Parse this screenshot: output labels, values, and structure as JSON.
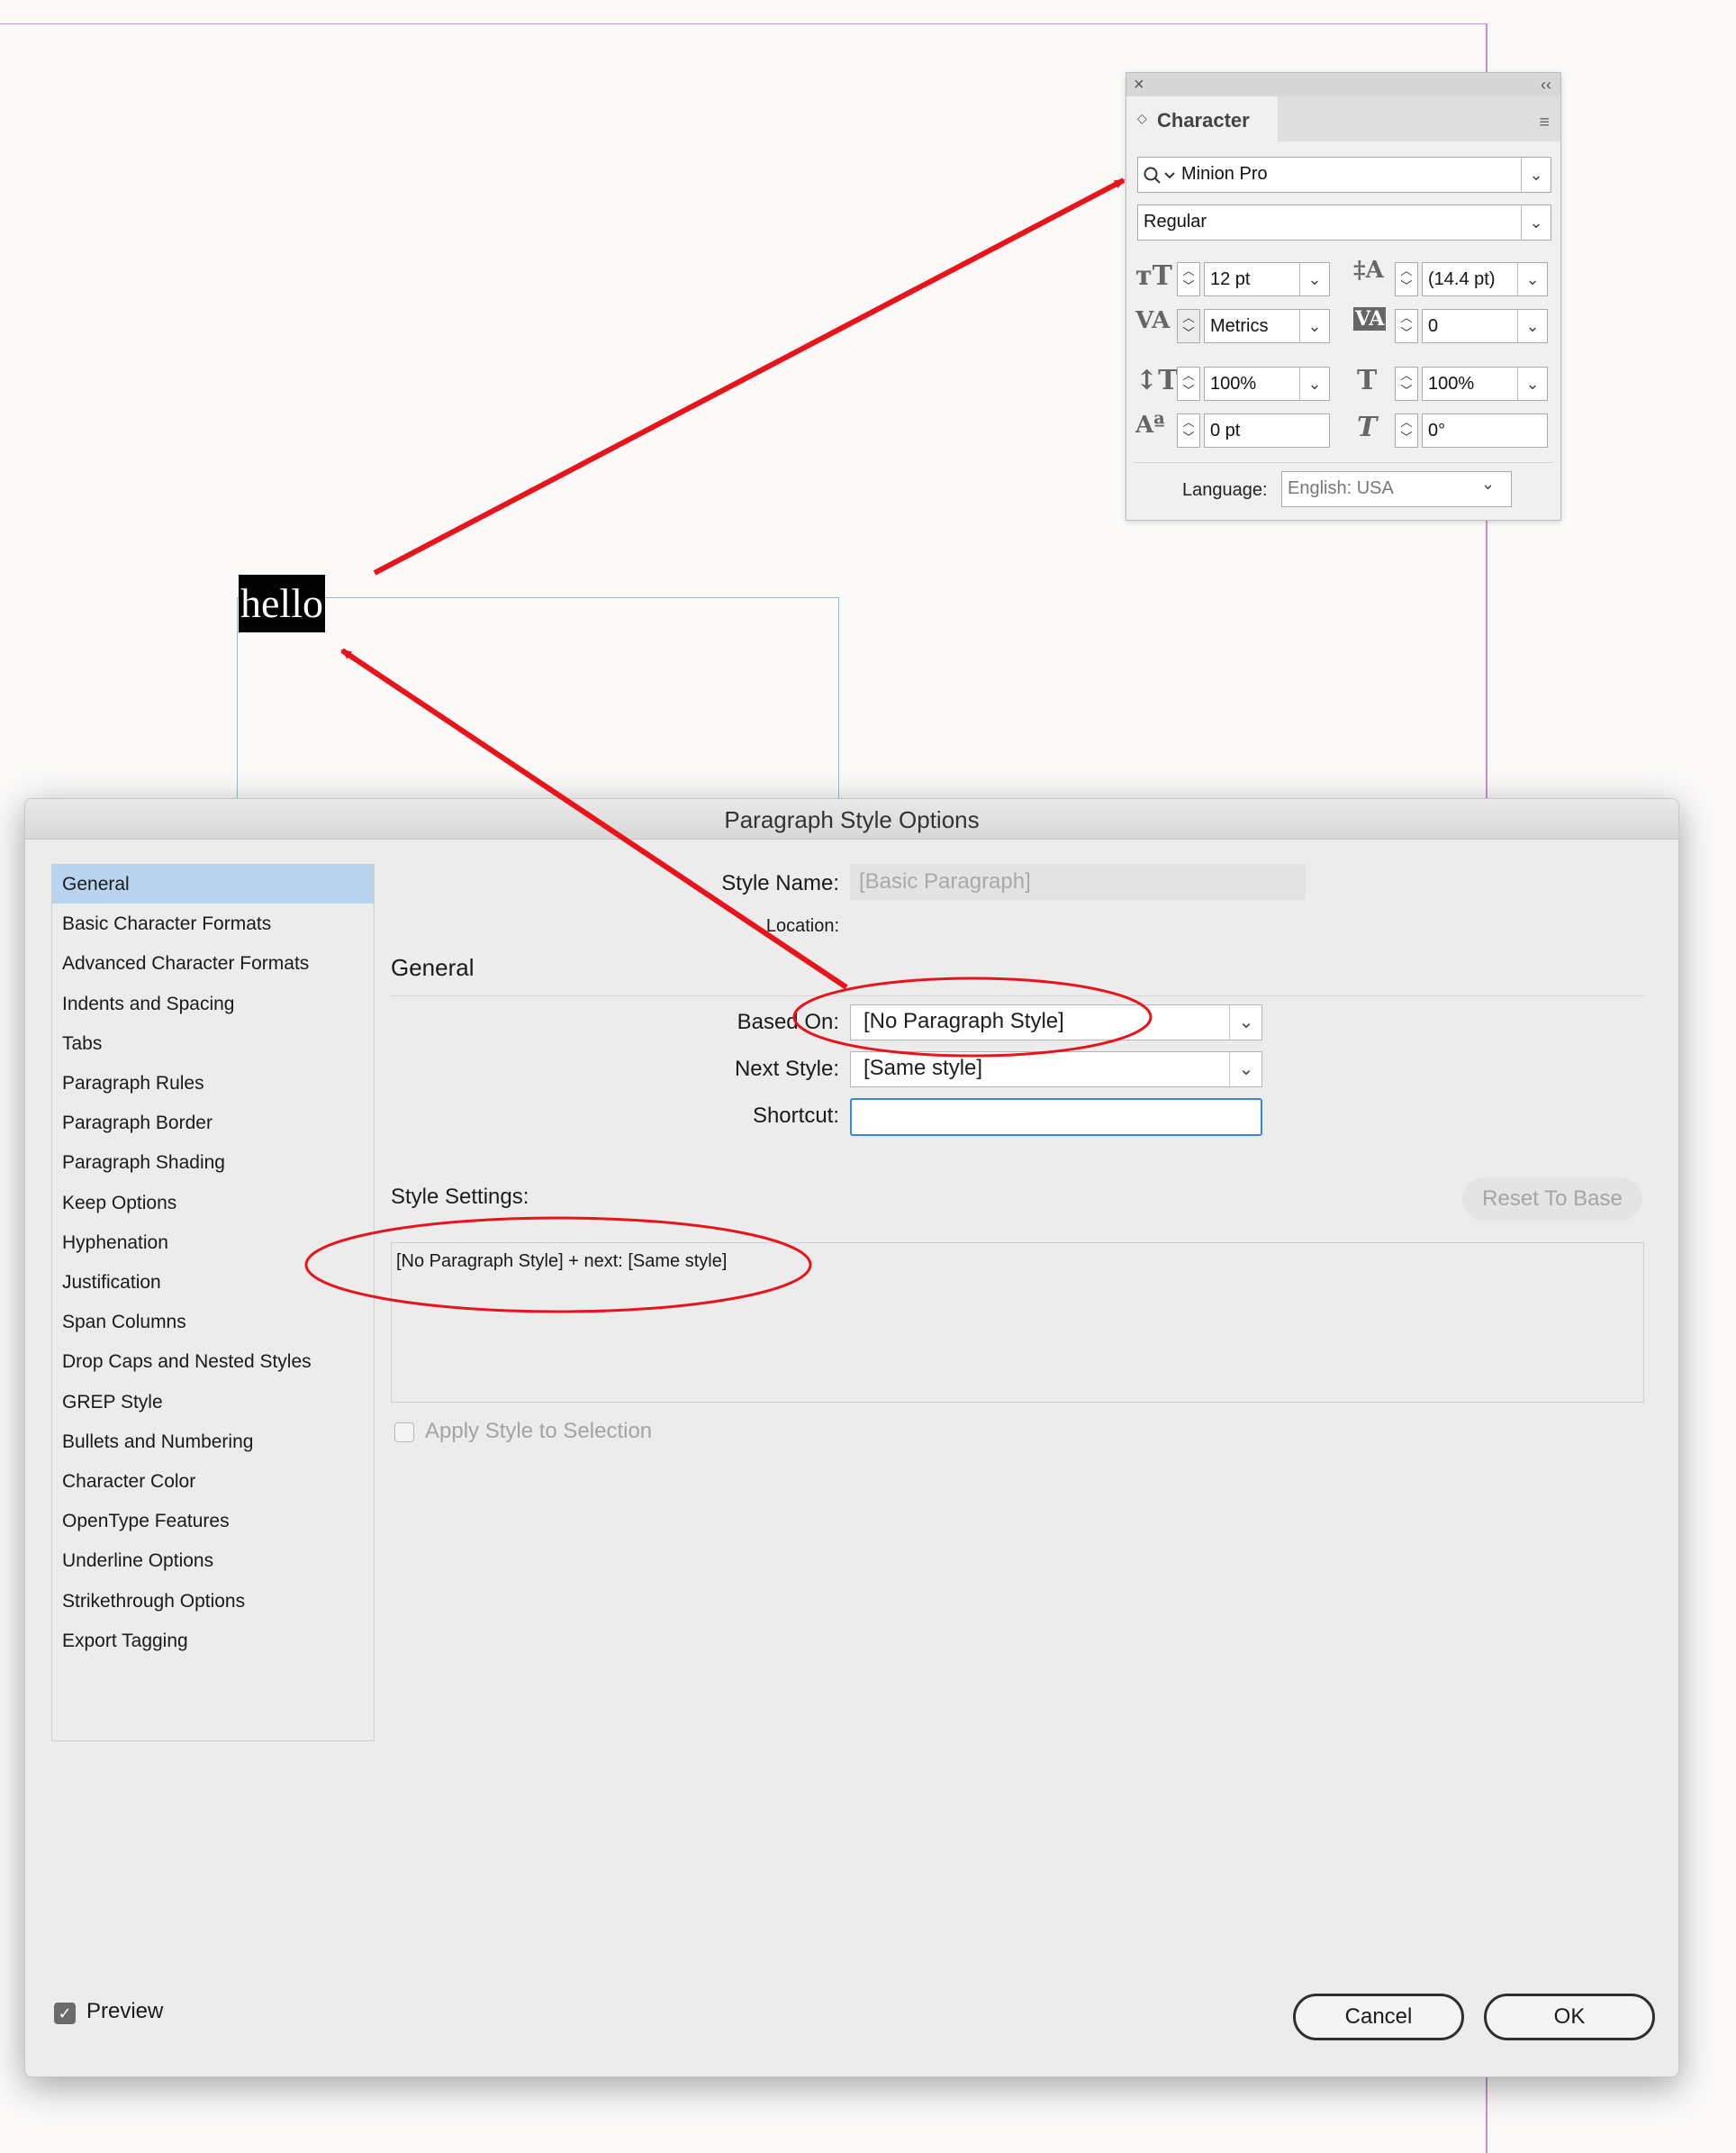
{
  "canvas": {
    "sample_text": "hello"
  },
  "character_panel": {
    "title": "Character",
    "font_family": "Minion Pro",
    "font_style": "Regular",
    "font_size": "12 pt",
    "leading": "(14.4 pt)",
    "kerning": "Metrics",
    "tracking": "0",
    "vertical_scale": "100%",
    "horizontal_scale": "100%",
    "baseline_shift": "0 pt",
    "skew": "0°",
    "language_label": "Language:",
    "language": "English: USA"
  },
  "dialog": {
    "title": "Paragraph Style Options",
    "categories": [
      "General",
      "Basic Character Formats",
      "Advanced Character Formats",
      "Indents and Spacing",
      "Tabs",
      "Paragraph Rules",
      "Paragraph Border",
      "Paragraph Shading",
      "Keep Options",
      "Hyphenation",
      "Justification",
      "Span Columns",
      "Drop Caps and Nested Styles",
      "GREP Style",
      "Bullets and Numbering",
      "Character Color",
      "OpenType Features",
      "Underline Options",
      "Strikethrough Options",
      "Export Tagging"
    ],
    "selected_category": "General",
    "style_name_label": "Style Name:",
    "style_name": "[Basic Paragraph]",
    "location_label": "Location:",
    "section_title": "General",
    "based_on_label": "Based On:",
    "based_on": "[No Paragraph Style]",
    "next_style_label": "Next Style:",
    "next_style": "[Same style]",
    "shortcut_label": "Shortcut:",
    "shortcut": "",
    "style_settings_label": "Style Settings:",
    "reset_to_base": "Reset To Base",
    "style_settings_text": "[No Paragraph Style] + next: [Same style]",
    "apply_style_label": "Apply Style to Selection",
    "preview_label": "Preview",
    "preview_checked": true,
    "cancel_label": "Cancel",
    "ok_label": "OK"
  },
  "annotation_color": "#e8141c"
}
